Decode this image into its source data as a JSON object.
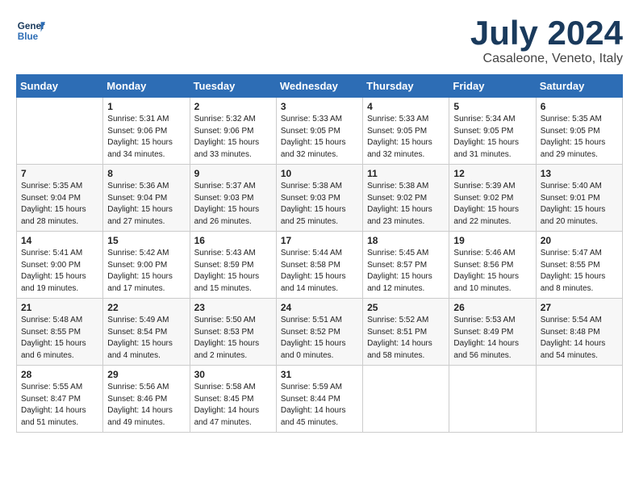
{
  "header": {
    "logo_line1": "General",
    "logo_line2": "Blue",
    "month": "July 2024",
    "location": "Casaleone, Veneto, Italy"
  },
  "weekdays": [
    "Sunday",
    "Monday",
    "Tuesday",
    "Wednesday",
    "Thursday",
    "Friday",
    "Saturday"
  ],
  "weeks": [
    [
      {
        "day": "",
        "info": ""
      },
      {
        "day": "1",
        "info": "Sunrise: 5:31 AM\nSunset: 9:06 PM\nDaylight: 15 hours\nand 34 minutes."
      },
      {
        "day": "2",
        "info": "Sunrise: 5:32 AM\nSunset: 9:06 PM\nDaylight: 15 hours\nand 33 minutes."
      },
      {
        "day": "3",
        "info": "Sunrise: 5:33 AM\nSunset: 9:05 PM\nDaylight: 15 hours\nand 32 minutes."
      },
      {
        "day": "4",
        "info": "Sunrise: 5:33 AM\nSunset: 9:05 PM\nDaylight: 15 hours\nand 32 minutes."
      },
      {
        "day": "5",
        "info": "Sunrise: 5:34 AM\nSunset: 9:05 PM\nDaylight: 15 hours\nand 31 minutes."
      },
      {
        "day": "6",
        "info": "Sunrise: 5:35 AM\nSunset: 9:05 PM\nDaylight: 15 hours\nand 29 minutes."
      }
    ],
    [
      {
        "day": "7",
        "info": "Sunrise: 5:35 AM\nSunset: 9:04 PM\nDaylight: 15 hours\nand 28 minutes."
      },
      {
        "day": "8",
        "info": "Sunrise: 5:36 AM\nSunset: 9:04 PM\nDaylight: 15 hours\nand 27 minutes."
      },
      {
        "day": "9",
        "info": "Sunrise: 5:37 AM\nSunset: 9:03 PM\nDaylight: 15 hours\nand 26 minutes."
      },
      {
        "day": "10",
        "info": "Sunrise: 5:38 AM\nSunset: 9:03 PM\nDaylight: 15 hours\nand 25 minutes."
      },
      {
        "day": "11",
        "info": "Sunrise: 5:38 AM\nSunset: 9:02 PM\nDaylight: 15 hours\nand 23 minutes."
      },
      {
        "day": "12",
        "info": "Sunrise: 5:39 AM\nSunset: 9:02 PM\nDaylight: 15 hours\nand 22 minutes."
      },
      {
        "day": "13",
        "info": "Sunrise: 5:40 AM\nSunset: 9:01 PM\nDaylight: 15 hours\nand 20 minutes."
      }
    ],
    [
      {
        "day": "14",
        "info": "Sunrise: 5:41 AM\nSunset: 9:00 PM\nDaylight: 15 hours\nand 19 minutes."
      },
      {
        "day": "15",
        "info": "Sunrise: 5:42 AM\nSunset: 9:00 PM\nDaylight: 15 hours\nand 17 minutes."
      },
      {
        "day": "16",
        "info": "Sunrise: 5:43 AM\nSunset: 8:59 PM\nDaylight: 15 hours\nand 15 minutes."
      },
      {
        "day": "17",
        "info": "Sunrise: 5:44 AM\nSunset: 8:58 PM\nDaylight: 15 hours\nand 14 minutes."
      },
      {
        "day": "18",
        "info": "Sunrise: 5:45 AM\nSunset: 8:57 PM\nDaylight: 15 hours\nand 12 minutes."
      },
      {
        "day": "19",
        "info": "Sunrise: 5:46 AM\nSunset: 8:56 PM\nDaylight: 15 hours\nand 10 minutes."
      },
      {
        "day": "20",
        "info": "Sunrise: 5:47 AM\nSunset: 8:55 PM\nDaylight: 15 hours\nand 8 minutes."
      }
    ],
    [
      {
        "day": "21",
        "info": "Sunrise: 5:48 AM\nSunset: 8:55 PM\nDaylight: 15 hours\nand 6 minutes."
      },
      {
        "day": "22",
        "info": "Sunrise: 5:49 AM\nSunset: 8:54 PM\nDaylight: 15 hours\nand 4 minutes."
      },
      {
        "day": "23",
        "info": "Sunrise: 5:50 AM\nSunset: 8:53 PM\nDaylight: 15 hours\nand 2 minutes."
      },
      {
        "day": "24",
        "info": "Sunrise: 5:51 AM\nSunset: 8:52 PM\nDaylight: 15 hours\nand 0 minutes."
      },
      {
        "day": "25",
        "info": "Sunrise: 5:52 AM\nSunset: 8:51 PM\nDaylight: 14 hours\nand 58 minutes."
      },
      {
        "day": "26",
        "info": "Sunrise: 5:53 AM\nSunset: 8:49 PM\nDaylight: 14 hours\nand 56 minutes."
      },
      {
        "day": "27",
        "info": "Sunrise: 5:54 AM\nSunset: 8:48 PM\nDaylight: 14 hours\nand 54 minutes."
      }
    ],
    [
      {
        "day": "28",
        "info": "Sunrise: 5:55 AM\nSunset: 8:47 PM\nDaylight: 14 hours\nand 51 minutes."
      },
      {
        "day": "29",
        "info": "Sunrise: 5:56 AM\nSunset: 8:46 PM\nDaylight: 14 hours\nand 49 minutes."
      },
      {
        "day": "30",
        "info": "Sunrise: 5:58 AM\nSunset: 8:45 PM\nDaylight: 14 hours\nand 47 minutes."
      },
      {
        "day": "31",
        "info": "Sunrise: 5:59 AM\nSunset: 8:44 PM\nDaylight: 14 hours\nand 45 minutes."
      },
      {
        "day": "",
        "info": ""
      },
      {
        "day": "",
        "info": ""
      },
      {
        "day": "",
        "info": ""
      }
    ]
  ]
}
